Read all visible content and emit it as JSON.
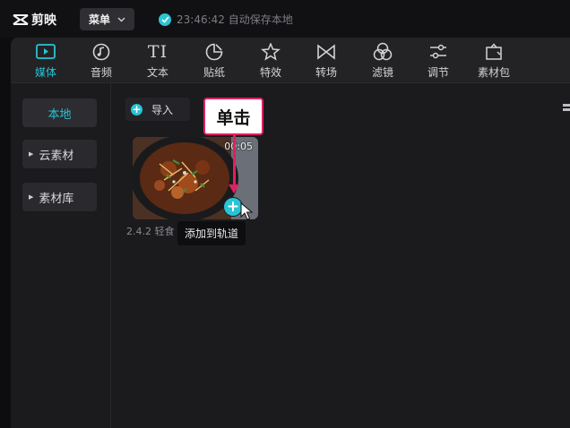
{
  "app": {
    "name": "剪映"
  },
  "titlebar": {
    "menu_label": "菜单",
    "save_status": "23:46:42 自动保存本地"
  },
  "toolbar": {
    "items": [
      {
        "label": "媒体",
        "icon": "media-icon",
        "active": true
      },
      {
        "label": "音频",
        "icon": "audio-icon"
      },
      {
        "label": "文本",
        "icon": "text-icon"
      },
      {
        "label": "贴纸",
        "icon": "sticker-icon"
      },
      {
        "label": "特效",
        "icon": "effects-icon"
      },
      {
        "label": "转场",
        "icon": "transition-icon"
      },
      {
        "label": "滤镜",
        "icon": "filter-icon"
      },
      {
        "label": "调节",
        "icon": "adjust-icon"
      },
      {
        "label": "素材包",
        "icon": "package-icon"
      }
    ]
  },
  "sidebar": {
    "items": [
      {
        "label": "本地",
        "active": true
      },
      {
        "label": "云素材"
      },
      {
        "label": "素材库"
      }
    ]
  },
  "content": {
    "import_label": "导入",
    "media": {
      "duration": "00:05",
      "name": "2.4.2  轻食",
      "tooltip": "添加到轨道"
    }
  },
  "annotation": {
    "callout_text": "单击",
    "color": "#e0215f"
  },
  "colors": {
    "accent": "#27c4d5",
    "background": "#1b1b1e"
  }
}
